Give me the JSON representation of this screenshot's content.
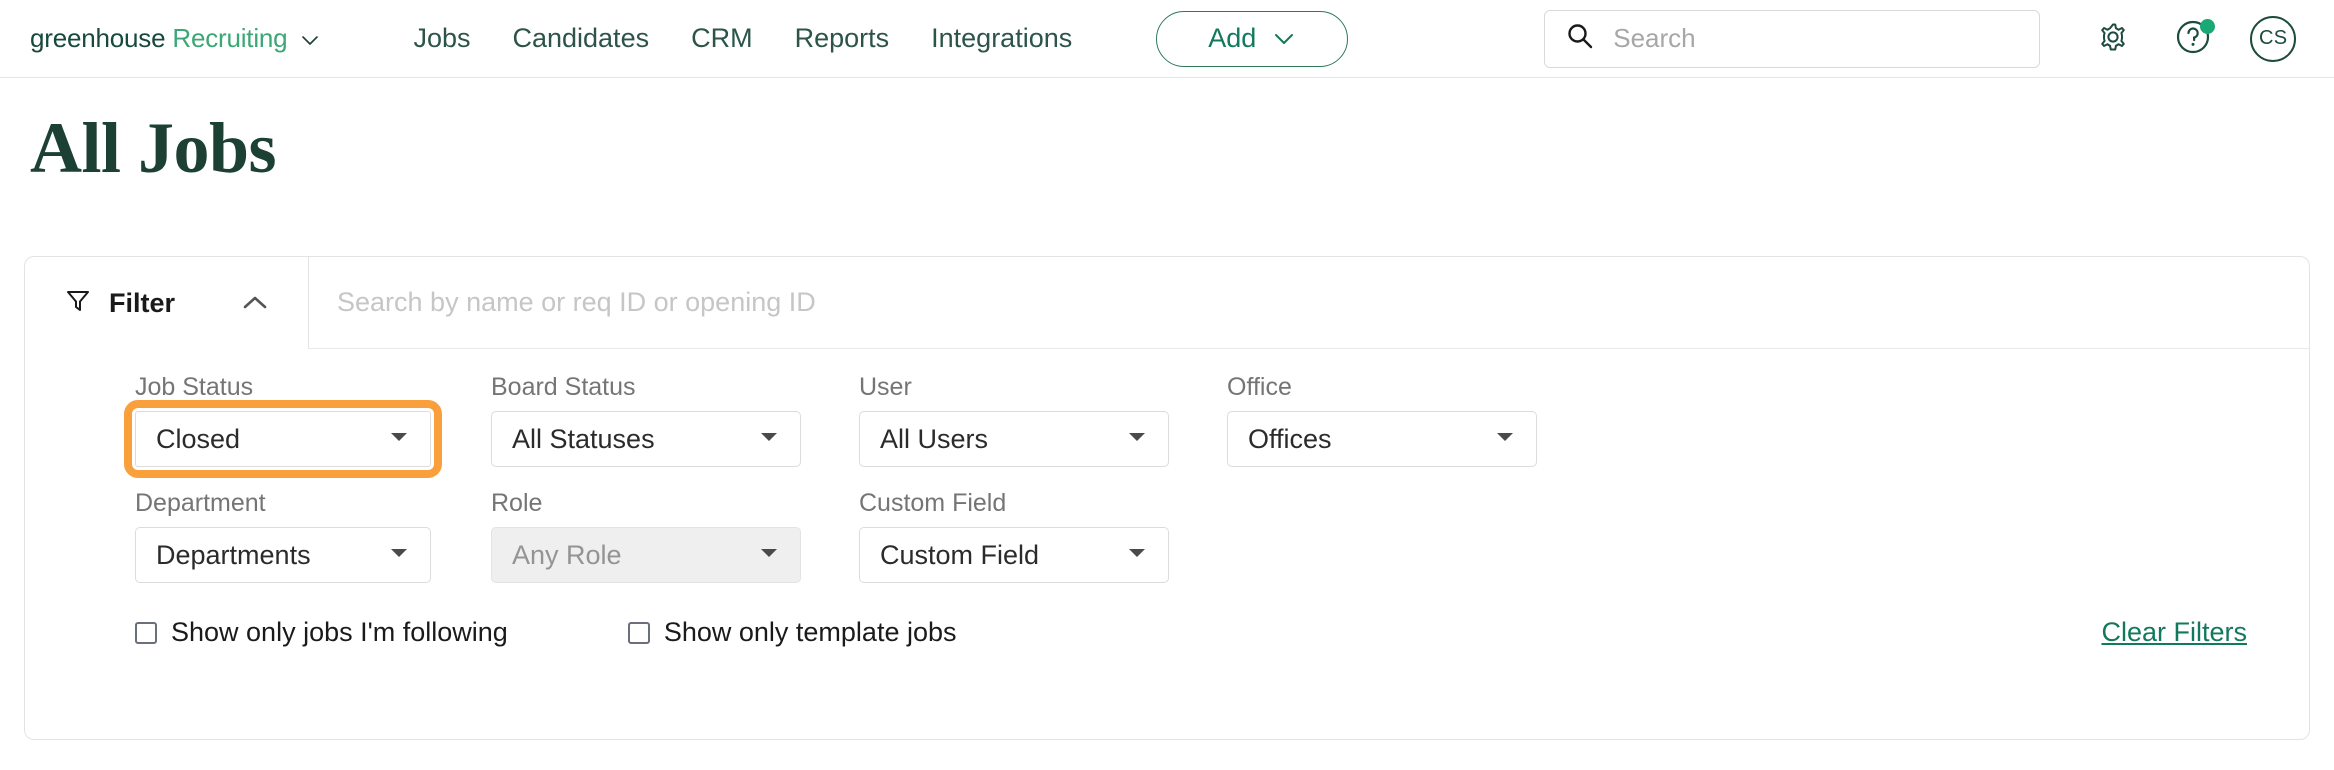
{
  "brand": {
    "name_primary": "greenhouse",
    "name_secondary": "Recruiting",
    "caret_icon": "chevron-down-icon"
  },
  "nav": {
    "links": [
      {
        "label": "Jobs"
      },
      {
        "label": "Candidates"
      },
      {
        "label": "CRM"
      },
      {
        "label": "Reports"
      },
      {
        "label": "Integrations"
      }
    ],
    "add_button": {
      "label": "Add",
      "icon": "chevron-down-icon"
    },
    "global_search": {
      "value": "",
      "placeholder": "Search",
      "icon": "search-icon"
    },
    "icons": [
      {
        "name": "gear-icon"
      },
      {
        "name": "help-circle-icon",
        "has_notification": true
      }
    ],
    "avatar": {
      "initials": "CS"
    }
  },
  "page": {
    "title": "All Jobs"
  },
  "filter_panel": {
    "filter_label": "Filter",
    "filter_icon": "funnel-icon",
    "collapse_icon": "chevron-up-icon",
    "search": {
      "value": "",
      "placeholder": "Search by name or req ID or opening ID"
    },
    "fields_row1": [
      {
        "label": "Job Status",
        "value": "Closed",
        "disabled": false,
        "highlighted": true
      },
      {
        "label": "Board Status",
        "value": "All Statuses",
        "disabled": false,
        "highlighted": false
      },
      {
        "label": "User",
        "value": "All Users",
        "disabled": false,
        "highlighted": false
      },
      {
        "label": "Office",
        "value": "Offices",
        "disabled": false,
        "highlighted": false
      }
    ],
    "fields_row2": [
      {
        "label": "Department",
        "value": "Departments",
        "disabled": false,
        "highlighted": false
      },
      {
        "label": "Role",
        "value": "Any Role",
        "disabled": true,
        "highlighted": false
      },
      {
        "label": "Custom Field",
        "value": "Custom Field",
        "disabled": false,
        "highlighted": false
      }
    ],
    "checkboxes": [
      {
        "label": "Show only jobs I'm following",
        "checked": false
      },
      {
        "label": "Show only template jobs",
        "checked": false
      }
    ],
    "clear_filters_label": "Clear Filters"
  },
  "colors": {
    "brand_green": "#17493d",
    "brand_teal": "#3ba776",
    "accent_link": "#12795c",
    "highlight_orange": "#f9a03c",
    "notification_green": "#19a974"
  }
}
